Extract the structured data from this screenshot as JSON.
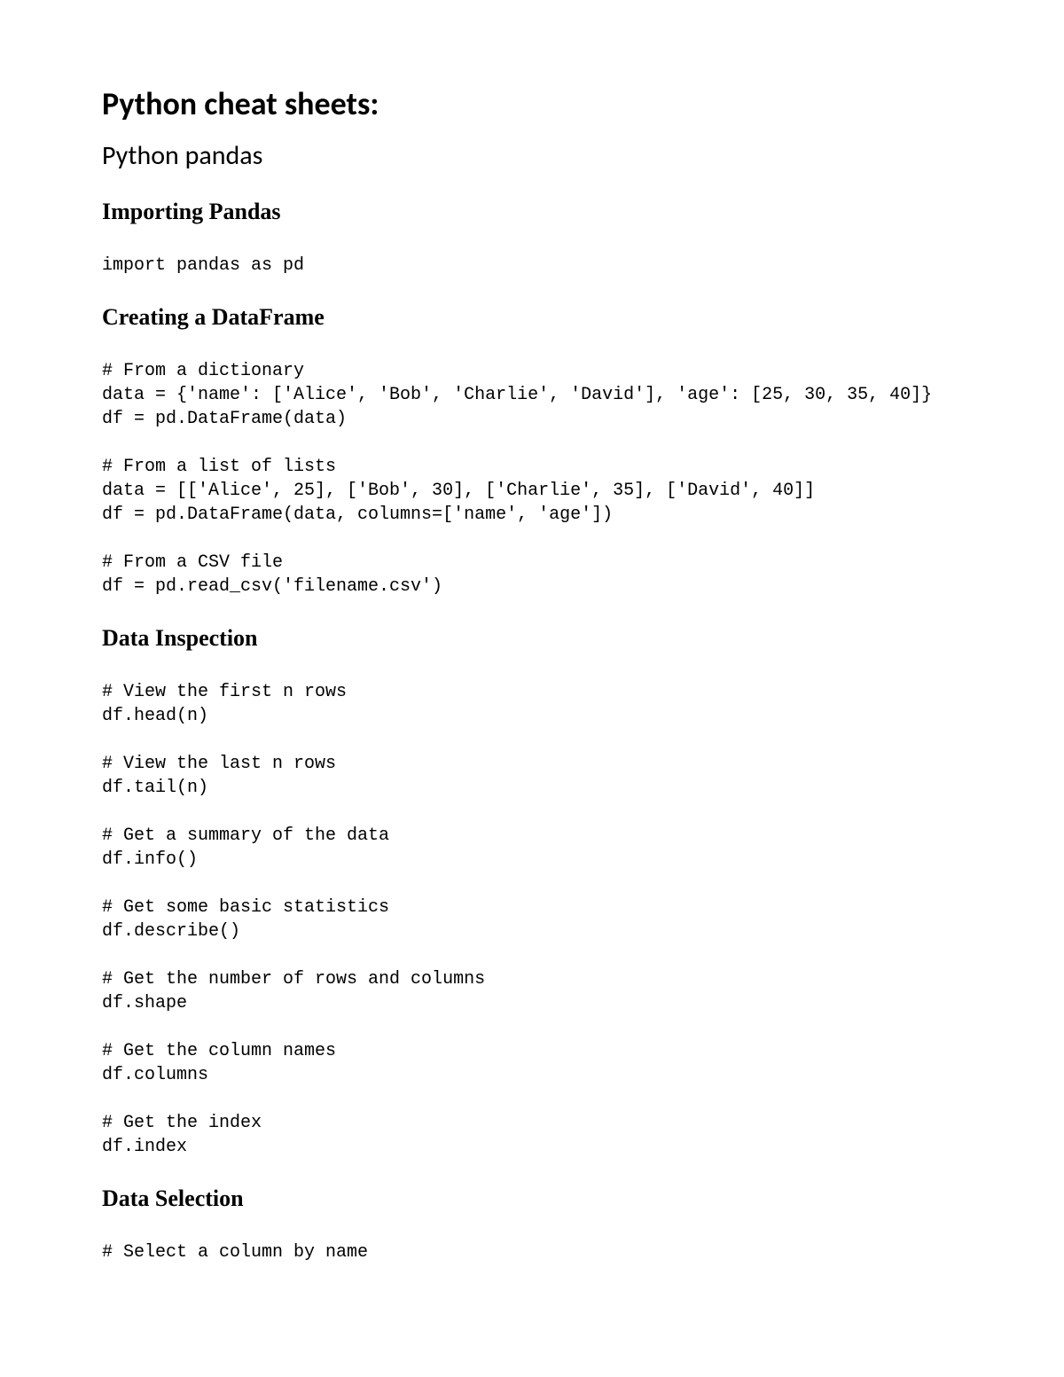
{
  "title": "Python cheat sheets:",
  "subtitle": "Python pandas",
  "sections": [
    {
      "heading": "Importing Pandas",
      "code": "import pandas as pd"
    },
    {
      "heading": "Creating a DataFrame",
      "code": "# From a dictionary\ndata = {'name': ['Alice', 'Bob', 'Charlie', 'David'], 'age': [25, 30, 35, 40]}\ndf = pd.DataFrame(data)\n\n# From a list of lists\ndata = [['Alice', 25], ['Bob', 30], ['Charlie', 35], ['David', 40]]\ndf = pd.DataFrame(data, columns=['name', 'age'])\n\n# From a CSV file\ndf = pd.read_csv('filename.csv')"
    },
    {
      "heading": "Data Inspection",
      "code": "# View the first n rows\ndf.head(n)\n\n# View the last n rows\ndf.tail(n)\n\n# Get a summary of the data\ndf.info()\n\n# Get some basic statistics\ndf.describe()\n\n# Get the number of rows and columns\ndf.shape\n\n# Get the column names\ndf.columns\n\n# Get the index\ndf.index"
    },
    {
      "heading": "Data Selection",
      "code": "# Select a column by name"
    }
  ]
}
